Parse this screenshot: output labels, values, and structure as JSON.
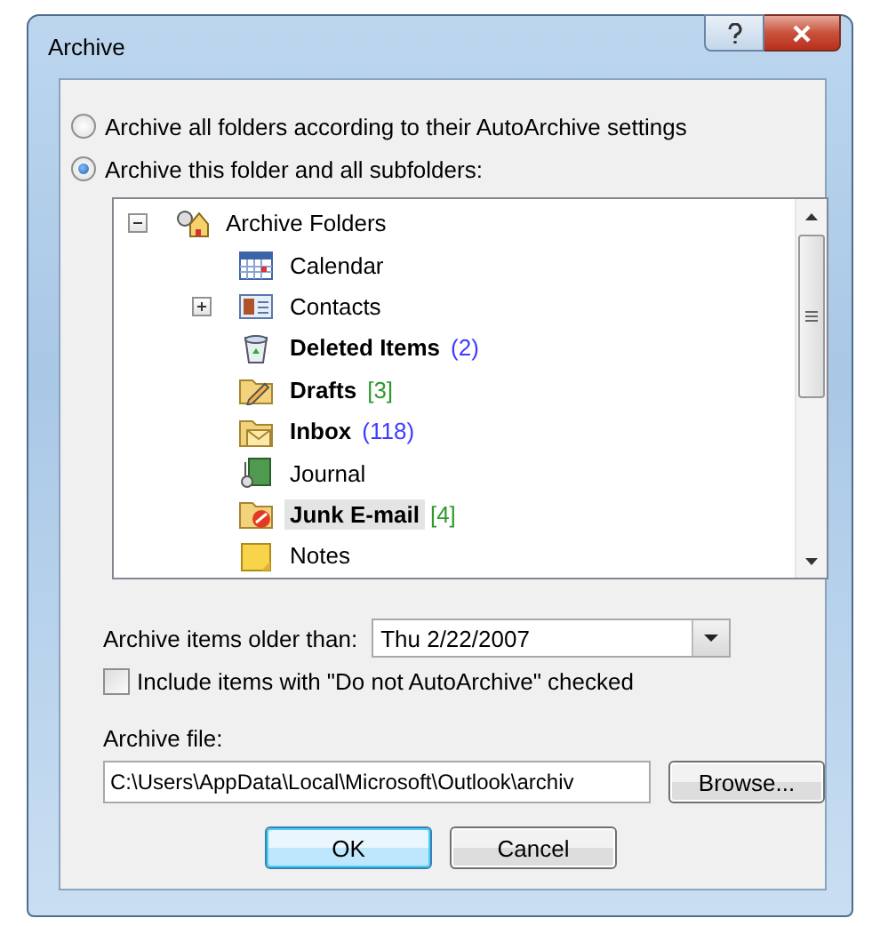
{
  "window": {
    "title": "Archive"
  },
  "options": [
    {
      "label": "Archive all folders according to their AutoArchive settings",
      "selected": false
    },
    {
      "label": "Archive this folder and all subfolders:",
      "selected": true
    }
  ],
  "tree": {
    "root": {
      "name": "Archive Folders",
      "has_children": true,
      "expanded": true,
      "bold": false,
      "selected": false,
      "children": [
        {
          "name": "Calendar",
          "kind": "calendar",
          "has_children": false,
          "bold": false,
          "selected": false
        },
        {
          "name": "Contacts",
          "kind": "contacts",
          "has_children": true,
          "expanded": false,
          "bold": false,
          "selected": false
        },
        {
          "name": "Deleted Items",
          "kind": "trash",
          "has_children": false,
          "bold": true,
          "count": "(2)",
          "color": "#3c3cff",
          "selected": false
        },
        {
          "name": "Drafts",
          "kind": "drafts",
          "has_children": false,
          "bold": true,
          "count": "[3]",
          "color": "#2e9a2e",
          "selected": false
        },
        {
          "name": "Inbox",
          "kind": "inbox",
          "has_children": false,
          "bold": true,
          "count": "(118)",
          "color": "#3c3cff",
          "selected": false
        },
        {
          "name": "Journal",
          "kind": "journal",
          "has_children": false,
          "bold": false,
          "selected": false
        },
        {
          "name": "Junk E-mail",
          "kind": "junk",
          "has_children": false,
          "bold": true,
          "count": "[4]",
          "color": "#2e9a2e",
          "selected": true
        },
        {
          "name": "Notes",
          "kind": "notes",
          "has_children": false,
          "bold": false,
          "selected": false
        }
      ]
    }
  },
  "older_than": {
    "label": "Archive items older than:",
    "value": "Thu 2/22/2007"
  },
  "include_checkbox": {
    "label": "Include items with \"Do not AutoArchive\" checked",
    "checked": false
  },
  "archive_file": {
    "label": "Archive file:",
    "value": "C:\\Users\\AppData\\Local\\Microsoft\\Outlook\\archiv",
    "browse": "Browse..."
  },
  "buttons": [
    {
      "label": "OK",
      "default": true
    },
    {
      "label": "Cancel",
      "default": false
    }
  ]
}
